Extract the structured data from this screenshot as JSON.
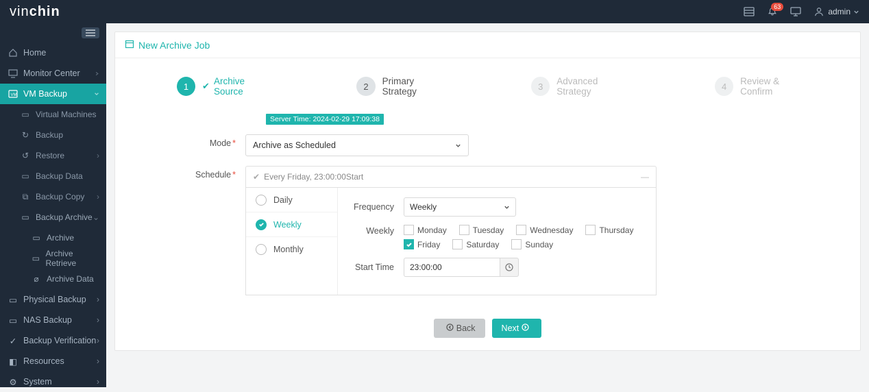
{
  "brand": {
    "part1": "vin",
    "part2": "chin"
  },
  "header": {
    "notifications": "63",
    "user": "admin"
  },
  "sidebar": {
    "items": [
      {
        "label": "Home"
      },
      {
        "label": "Monitor Center"
      },
      {
        "label": "VM Backup",
        "active": true
      },
      {
        "label": "Physical Backup"
      },
      {
        "label": "NAS Backup"
      },
      {
        "label": "Backup Verification"
      },
      {
        "label": "Resources"
      },
      {
        "label": "System"
      }
    ],
    "vm_sub": [
      {
        "label": "Virtual Machines"
      },
      {
        "label": "Backup"
      },
      {
        "label": "Restore"
      },
      {
        "label": "Backup Data"
      },
      {
        "label": "Backup Copy"
      },
      {
        "label": "Backup Archive"
      }
    ],
    "archive_sub": [
      {
        "label": "Archive"
      },
      {
        "label": "Archive Retrieve"
      },
      {
        "label": "Archive Data"
      }
    ]
  },
  "page": {
    "title": "New Archive Job",
    "steps": [
      {
        "num": "1",
        "label": "Archive Source"
      },
      {
        "num": "2",
        "label": "Primary Strategy"
      },
      {
        "num": "3",
        "label": "Advanced Strategy"
      },
      {
        "num": "4",
        "label": "Review & Confirm"
      }
    ],
    "server_time_label": "Server Time:",
    "server_time_value": "2024-02-29 17:09:38",
    "mode_label": "Mode",
    "mode_value": "Archive as Scheduled",
    "schedule_label": "Schedule",
    "schedule_summary": "Every Friday, 23:00:00Start",
    "intervals": {
      "daily": "Daily",
      "weekly": "Weekly",
      "monthly": "Monthly"
    },
    "frequency_label": "Frequency",
    "frequency_value": "Weekly",
    "weekly_label": "Weekly",
    "days": {
      "mon": "Monday",
      "tue": "Tuesday",
      "wed": "Wednesday",
      "thu": "Thursday",
      "fri": "Friday",
      "sat": "Saturday",
      "sun": "Sunday"
    },
    "start_time_label": "Start Time",
    "start_time_value": "23:00:00",
    "back": "Back",
    "next": "Next"
  }
}
